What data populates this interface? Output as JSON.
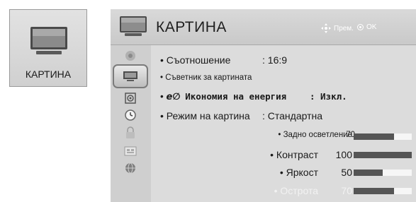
{
  "tile": {
    "label": "КАРТИНА",
    "icon": "tv-icon"
  },
  "header": {
    "title": "КАРТИНА",
    "hint_move": "Прем.",
    "hint_ok": "OK"
  },
  "sidebar": {
    "items": [
      {
        "name": "sidebar-item-audio",
        "icon": "speaker-icon"
      },
      {
        "name": "sidebar-item-picture",
        "icon": "tv-icon",
        "selected": true
      },
      {
        "name": "sidebar-item-sound",
        "icon": "audio-icon"
      },
      {
        "name": "sidebar-item-time",
        "icon": "clock-icon"
      },
      {
        "name": "sidebar-item-lock",
        "icon": "lock-icon"
      },
      {
        "name": "sidebar-item-options",
        "icon": "options-icon"
      },
      {
        "name": "sidebar-item-network",
        "icon": "globe-icon"
      }
    ]
  },
  "menu": {
    "aspect_ratio": {
      "label": "• Съотношение",
      "value": ": 16:9"
    },
    "wizard": {
      "label": "• Съветник за картината"
    },
    "energy": {
      "bullet": "•",
      "eco": "e∅",
      "label": "Икономия на енергия",
      "value": ": Изкл."
    },
    "picture_mode": {
      "label": "• Режим на картина",
      "value": ": Стандартна"
    },
    "sliders": [
      {
        "label": "• Задно осветление",
        "value": "70",
        "level": 0.7,
        "dimmed": false
      },
      {
        "label": "• Контраст",
        "value": "100",
        "level": 1.0,
        "dimmed": false
      },
      {
        "label": "• Яркост",
        "value": "50",
        "level": 0.5,
        "dimmed": false
      },
      {
        "label": "• Острота",
        "value": "70",
        "level": 0.7,
        "dimmed": true
      }
    ]
  },
  "colors": {
    "panel_bg": "#d8d8d8",
    "bar_fill": "#555555",
    "bar_track": "#f6f6f6",
    "hint_text": "#ffffff"
  }
}
